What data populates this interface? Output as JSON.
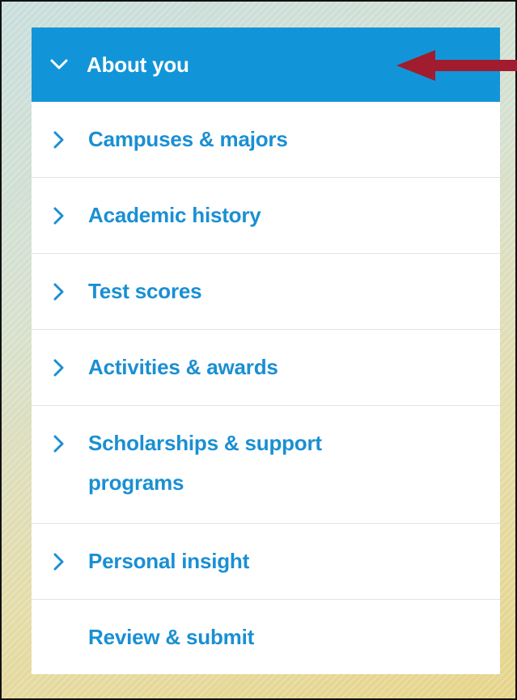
{
  "menu": {
    "items": [
      {
        "label": "About you",
        "state": "expanded",
        "icon": "chevron-down-icon"
      },
      {
        "label": "Campuses & majors",
        "state": "collapsed",
        "icon": "chevron-right-icon"
      },
      {
        "label": "Academic history",
        "state": "collapsed",
        "icon": "chevron-right-icon"
      },
      {
        "label": "Test scores",
        "state": "collapsed",
        "icon": "chevron-right-icon"
      },
      {
        "label": "Activities & awards",
        "state": "collapsed",
        "icon": "chevron-right-icon"
      },
      {
        "label_line1": "Scholarships & support",
        "label_line2": "programs",
        "state": "collapsed",
        "icon": "chevron-right-icon"
      },
      {
        "label": "Personal insight",
        "state": "collapsed",
        "icon": "chevron-right-icon"
      },
      {
        "label": "Review & submit",
        "state": "no-children"
      }
    ]
  },
  "colors": {
    "active_background": "#1295d8",
    "link_text": "#1a8fd3",
    "annotation_arrow": "#a01c2e"
  }
}
